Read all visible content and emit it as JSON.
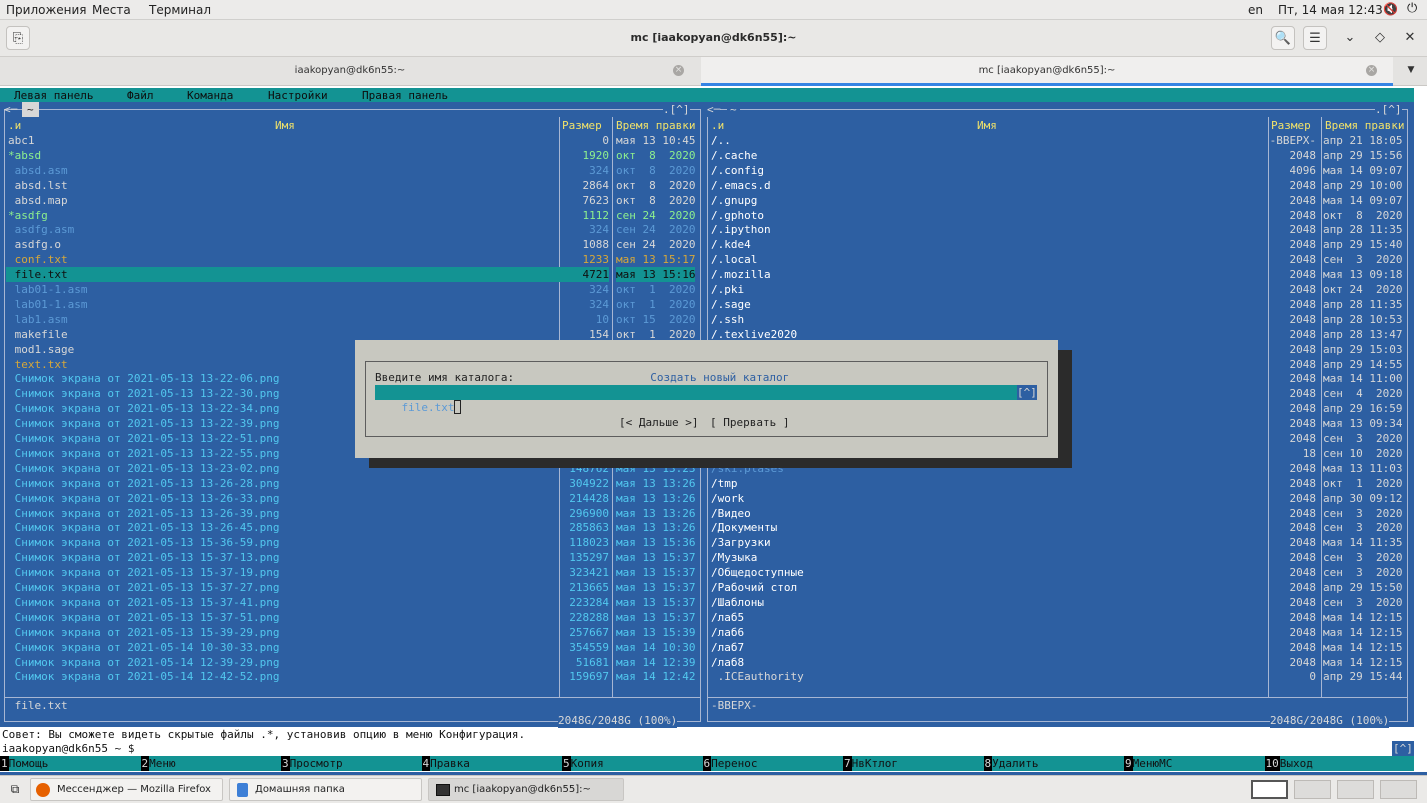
{
  "topbar": {
    "apps": "Приложения",
    "places": "Места",
    "terminal": "Терминал",
    "lang": "en",
    "clock": "Пт, 14 мая 12:43"
  },
  "window": {
    "title": "mc [iaakopyan@dk6n55]:~"
  },
  "tabs": [
    {
      "label": "iaakopyan@dk6n55:~"
    },
    {
      "label": "mc [iaakopyan@dk6n55]:~"
    }
  ],
  "mcmenu": {
    "left": "Левая панель",
    "file": "Файл",
    "command": "Команда",
    "settings": "Настройки",
    "right": "Правая панель"
  },
  "left_panel": {
    "path": "~",
    "corner": ".[^]",
    "col_n": ".и",
    "col_name": "Имя",
    "col_size": "Размер",
    "col_time": "Время правки",
    "rows": [
      {
        "name": "abc1",
        "size": "0",
        "time": "мая 13 10:45",
        "c": "def"
      },
      {
        "name": "*absd",
        "size": "1920",
        "time": "окт  8  2020",
        "c": "exe"
      },
      {
        "name": " absd.asm",
        "size": "324",
        "time": "окт  8  2020",
        "c": "dim"
      },
      {
        "name": " absd.lst",
        "size": "2864",
        "time": "окт  8  2020",
        "c": "def"
      },
      {
        "name": " absd.map",
        "size": "7623",
        "time": "окт  8  2020",
        "c": "def"
      },
      {
        "name": "*asdfg",
        "size": "1112",
        "time": "сен 24  2020",
        "c": "exe"
      },
      {
        "name": " asdfg.asm",
        "size": "324",
        "time": "сен 24  2020",
        "c": "dim"
      },
      {
        "name": " asdfg.o",
        "size": "1088",
        "time": "сен 24  2020",
        "c": "def"
      },
      {
        "name": " conf.txt",
        "size": "1233",
        "time": "мая 13 15:17",
        "c": "arch"
      },
      {
        "name": " file.txt",
        "size": "4721",
        "time": "мая 13 15:16",
        "c": "sel"
      },
      {
        "name": " lab01-1.asm",
        "size": "324",
        "time": "окт  1  2020",
        "c": "dim"
      },
      {
        "name": " lab01-1.asm",
        "size": "324",
        "time": "окт  1  2020",
        "c": "dim"
      },
      {
        "name": " lab1.asm",
        "size": "10",
        "time": "окт 15  2020",
        "c": "dim"
      },
      {
        "name": " makefile",
        "size": "154",
        "time": "окт  1  2020",
        "c": "def"
      },
      {
        "name": " mod1.sage",
        "size": "",
        "time": "",
        "c": "def"
      },
      {
        "name": " text.txt",
        "size": "",
        "time": "",
        "c": "arch"
      },
      {
        "name": " Снимок экрана от 2021-05-13 13-22-06.png",
        "size": "",
        "time": "",
        "c": "img"
      },
      {
        "name": " Снимок экрана от 2021-05-13 13-22-30.png",
        "size": "",
        "time": "",
        "c": "img"
      },
      {
        "name": " Снимок экрана от 2021-05-13 13-22-34.png",
        "size": "",
        "time": "",
        "c": "img"
      },
      {
        "name": " Снимок экрана от 2021-05-13 13-22-39.png",
        "size": "",
        "time": "",
        "c": "img"
      },
      {
        "name": " Снимок экрана от 2021-05-13 13-22-51.png",
        "size": "",
        "time": "",
        "c": "img"
      },
      {
        "name": " Снимок экрана от 2021-05-13 13-22-55.png",
        "size": "",
        "time": "",
        "c": "img"
      },
      {
        "name": " Снимок экрана от 2021-05-13 13-23-02.png",
        "size": "148762",
        "time": "мая 13 13:23",
        "c": "img"
      },
      {
        "name": " Снимок экрана от 2021-05-13 13-26-28.png",
        "size": "304922",
        "time": "мая 13 13:26",
        "c": "img"
      },
      {
        "name": " Снимок экрана от 2021-05-13 13-26-33.png",
        "size": "214428",
        "time": "мая 13 13:26",
        "c": "img"
      },
      {
        "name": " Снимок экрана от 2021-05-13 13-26-39.png",
        "size": "296900",
        "time": "мая 13 13:26",
        "c": "img"
      },
      {
        "name": " Снимок экрана от 2021-05-13 13-26-45.png",
        "size": "285863",
        "time": "мая 13 13:26",
        "c": "img"
      },
      {
        "name": " Снимок экрана от 2021-05-13 15-36-59.png",
        "size": "118023",
        "time": "мая 13 15:36",
        "c": "img"
      },
      {
        "name": " Снимок экрана от 2021-05-13 15-37-13.png",
        "size": "135297",
        "time": "мая 13 15:37",
        "c": "img"
      },
      {
        "name": " Снимок экрана от 2021-05-13 15-37-19.png",
        "size": "323421",
        "time": "мая 13 15:37",
        "c": "img"
      },
      {
        "name": " Снимок экрана от 2021-05-13 15-37-27.png",
        "size": "213665",
        "time": "мая 13 15:37",
        "c": "img"
      },
      {
        "name": " Снимок экрана от 2021-05-13 15-37-41.png",
        "size": "223284",
        "time": "мая 13 15:37",
        "c": "img"
      },
      {
        "name": " Снимок экрана от 2021-05-13 15-37-51.png",
        "size": "228288",
        "time": "мая 13 15:37",
        "c": "img"
      },
      {
        "name": " Снимок экрана от 2021-05-13 15-39-29.png",
        "size": "257667",
        "time": "мая 13 15:39",
        "c": "img"
      },
      {
        "name": " Снимок экрана от 2021-05-14 10-30-33.png",
        "size": "354559",
        "time": "мая 14 10:30",
        "c": "img"
      },
      {
        "name": " Снимок экрана от 2021-05-14 12-39-29.png",
        "size": "51681",
        "time": "мая 14 12:39",
        "c": "img"
      },
      {
        "name": " Снимок экрана от 2021-05-14 12-42-52.png",
        "size": "159697",
        "time": "мая 14 12:42",
        "c": "img"
      }
    ],
    "mini": " file.txt",
    "free": "2048G/2048G (100%)"
  },
  "right_panel": {
    "path": "~",
    "corner": ".[^]",
    "col_n": ".и",
    "col_name": "Имя",
    "col_size": "Размер",
    "col_time": "Время правки",
    "rows": [
      {
        "name": "/..",
        "size": "-ВВЕРХ-",
        "time": "апр 21 18:05"
      },
      {
        "name": "/.cache",
        "size": "2048",
        "time": "апр 29 15:56"
      },
      {
        "name": "/.config",
        "size": "4096",
        "time": "мая 14 09:07"
      },
      {
        "name": "/.emacs.d",
        "size": "2048",
        "time": "апр 29 10:00"
      },
      {
        "name": "/.gnupg",
        "size": "2048",
        "time": "мая 14 09:07"
      },
      {
        "name": "/.gphoto",
        "size": "2048",
        "time": "окт  8  2020"
      },
      {
        "name": "/.ipython",
        "size": "2048",
        "time": "апр 28 11:35"
      },
      {
        "name": "/.kde4",
        "size": "2048",
        "time": "апр 29 15:40"
      },
      {
        "name": "/.local",
        "size": "2048",
        "time": "сен  3  2020"
      },
      {
        "name": "/.mozilla",
        "size": "2048",
        "time": "мая 13 09:18"
      },
      {
        "name": "/.pki",
        "size": "2048",
        "time": "окт 24  2020"
      },
      {
        "name": "/.sage",
        "size": "2048",
        "time": "апр 28 11:35"
      },
      {
        "name": "/.ssh",
        "size": "2048",
        "time": "апр 28 10:53"
      },
      {
        "name": "/.texlive2020",
        "size": "2048",
        "time": "апр 28 13:47"
      },
      {
        "name": "",
        "size": "2048",
        "time": "апр 29 15:03"
      },
      {
        "name": "",
        "size": "2048",
        "time": "апр 29 14:55"
      },
      {
        "name": "",
        "size": "2048",
        "time": "мая 14 11:00"
      },
      {
        "name": "",
        "size": "2048",
        "time": "сен  4  2020"
      },
      {
        "name": "",
        "size": "2048",
        "time": "апр 29 16:59"
      },
      {
        "name": "",
        "size": "2048",
        "time": "мая 13 09:34"
      },
      {
        "name": "",
        "size": "2048",
        "time": "сен  3  2020"
      },
      {
        "name": "",
        "size": "18",
        "time": "сен 10  2020"
      },
      {
        "name": "/ski.plases",
        "size": "2048",
        "time": "мая 13 11:03"
      },
      {
        "name": "/tmp",
        "size": "2048",
        "time": "окт  1  2020"
      },
      {
        "name": "/work",
        "size": "2048",
        "time": "апр 30 09:12"
      },
      {
        "name": "/Видео",
        "size": "2048",
        "time": "сен  3  2020"
      },
      {
        "name": "/Документы",
        "size": "2048",
        "time": "сен  3  2020"
      },
      {
        "name": "/Загрузки",
        "size": "2048",
        "time": "мая 14 11:35"
      },
      {
        "name": "/Музыка",
        "size": "2048",
        "time": "сен  3  2020"
      },
      {
        "name": "/Общедоступные",
        "size": "2048",
        "time": "сен  3  2020"
      },
      {
        "name": "/Рабочий стол",
        "size": "2048",
        "time": "апр 29 15:50"
      },
      {
        "name": "/Шаблоны",
        "size": "2048",
        "time": "сен  3  2020"
      },
      {
        "name": "/лаб5",
        "size": "2048",
        "time": "мая 14 12:15"
      },
      {
        "name": "/лаб6",
        "size": "2048",
        "time": "мая 14 12:15"
      },
      {
        "name": "/лаб7",
        "size": "2048",
        "time": "мая 14 12:15"
      },
      {
        "name": "/лаб8",
        "size": "2048",
        "time": "мая 14 12:15"
      },
      {
        "name": " .ICEauthority",
        "size": "0",
        "time": "апр 29 15:44"
      }
    ],
    "mini": "-ВВЕРХ-",
    "free": "2048G/2048G (100%)"
  },
  "dialog": {
    "title": "Создать новый каталог",
    "prompt": "Введите имя каталога:",
    "value": "file.txt",
    "hist": "[^]",
    "ok": "[< Дальше >]",
    "cancel": "[ Прервать ]"
  },
  "hint": "Совет: Вы сможете видеть скрытые файлы .*, установив опцию в меню Конфигурация.",
  "prompt": "iaakopyan@dk6n55 ~ $",
  "prompt_hist": "[^]",
  "fkeys": [
    {
      "n": "1",
      "l": "Помощь"
    },
    {
      "n": "2",
      "l": "Меню"
    },
    {
      "n": "3",
      "l": "Просмотр"
    },
    {
      "n": "4",
      "l": "Правка"
    },
    {
      "n": "5",
      "l": "Копия"
    },
    {
      "n": "6",
      "l": "Перенос"
    },
    {
      "n": "7",
      "l": "НвКтлог"
    },
    {
      "n": "8",
      "l": "Удалить"
    },
    {
      "n": "9",
      "l": "МенюMC"
    },
    {
      "n": "10",
      "l": "Выход"
    }
  ],
  "taskbar": [
    {
      "label": "Мессенджер — Mozilla Firefox"
    },
    {
      "label": "Домашняя папка"
    },
    {
      "label": "mc [iaakopyan@dk6n55]:~"
    }
  ],
  "colors": {
    "panel": "#2d5fa2",
    "accent": "#139393",
    "dialog": "#c8c8c0"
  }
}
